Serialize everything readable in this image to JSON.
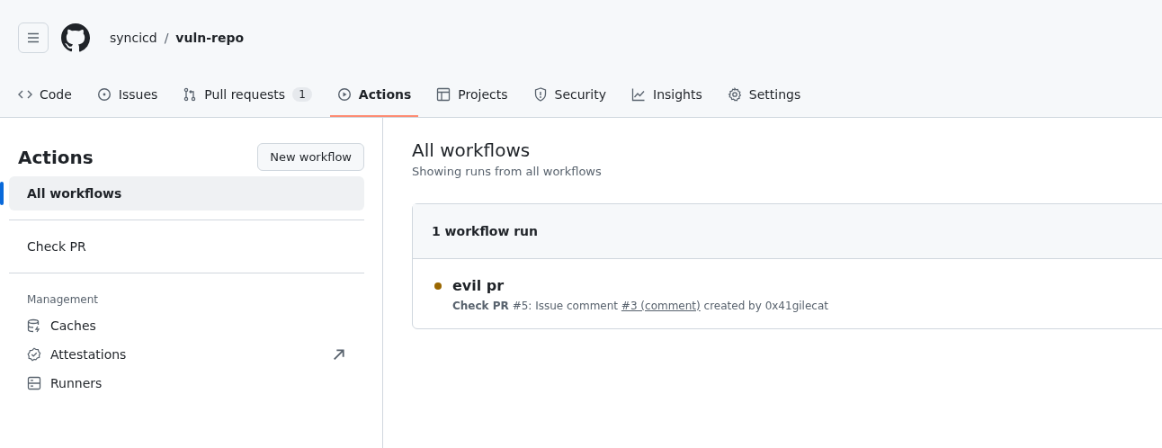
{
  "header": {
    "owner": "syncicd",
    "separator": "/",
    "repo": "vuln-repo"
  },
  "tabs": [
    {
      "kind": "code",
      "label": "Code",
      "selected": false
    },
    {
      "kind": "issues",
      "label": "Issues",
      "selected": false
    },
    {
      "kind": "pulls",
      "label": "Pull requests",
      "count": "1",
      "selected": false
    },
    {
      "kind": "actions",
      "label": "Actions",
      "selected": true
    },
    {
      "kind": "projects",
      "label": "Projects",
      "selected": false
    },
    {
      "kind": "security",
      "label": "Security",
      "selected": false
    },
    {
      "kind": "insights",
      "label": "Insights",
      "selected": false
    },
    {
      "kind": "settings",
      "label": "Settings",
      "selected": false
    }
  ],
  "sidebar": {
    "title": "Actions",
    "new_button": "New workflow",
    "workflows": [
      {
        "label": "All workflows",
        "selected": true
      },
      {
        "label": "Check PR",
        "selected": false
      }
    ],
    "management_heading": "Management",
    "management": [
      {
        "kind": "caches",
        "label": "Caches",
        "external": false
      },
      {
        "kind": "attestations",
        "label": "Attestations",
        "external": true
      },
      {
        "kind": "runners",
        "label": "Runners",
        "external": false
      }
    ]
  },
  "main": {
    "title": "All workflows",
    "subtitle": "Showing runs from all workflows",
    "count": "1 workflow run",
    "runs": [
      {
        "title": "evil pr",
        "color": "#9a6700",
        "workflow": "Check PR",
        "rest": "#5: Issue comment",
        "link": "#3 (comment)",
        "author": "created by 0x41gilecat"
      }
    ]
  }
}
